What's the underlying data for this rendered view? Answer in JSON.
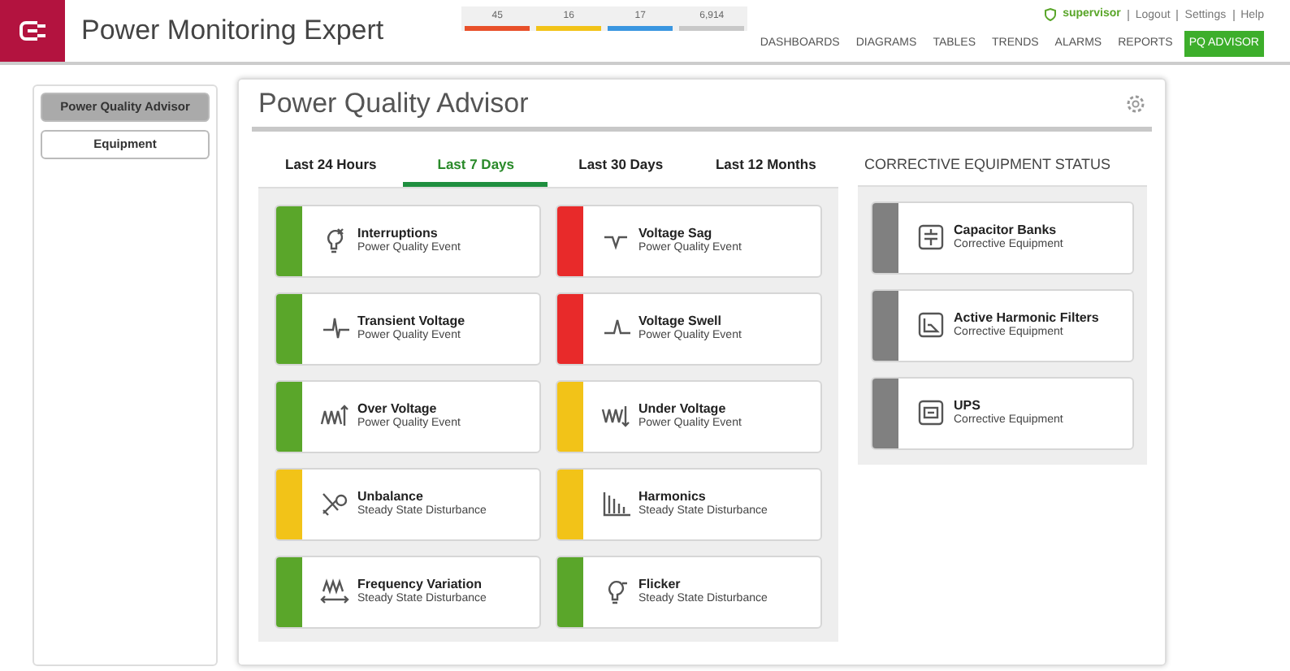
{
  "app": {
    "title": "Power Monitoring Expert"
  },
  "alarm_counts": [
    {
      "count": "45",
      "color": "#e8502a"
    },
    {
      "count": "16",
      "color": "#f2c318"
    },
    {
      "count": "17",
      "color": "#3a96e0"
    },
    {
      "count": "6,914",
      "color": "#c8c8c8"
    }
  ],
  "user_links": {
    "user": "supervisor",
    "links": [
      "Logout",
      "Settings",
      "Help"
    ]
  },
  "nav": [
    {
      "label": "DASHBOARDS",
      "selected": false
    },
    {
      "label": "DIAGRAMS",
      "selected": false
    },
    {
      "label": "TABLES",
      "selected": false
    },
    {
      "label": "TRENDS",
      "selected": false
    },
    {
      "label": "ALARMS",
      "selected": false
    },
    {
      "label": "REPORTS",
      "selected": false
    },
    {
      "label": "PQ ADVISOR",
      "selected": true
    }
  ],
  "sidebar": {
    "items": [
      {
        "label": "Power Quality Advisor",
        "selected": true
      },
      {
        "label": "Equipment",
        "selected": false
      }
    ]
  },
  "panel": {
    "title": "Power Quality Advisor"
  },
  "period_tabs": [
    {
      "label": "Last 24 Hours",
      "selected": false
    },
    {
      "label": "Last 7 Days",
      "selected": true
    },
    {
      "label": "Last 30 Days",
      "selected": false
    },
    {
      "label": "Last 12 Months",
      "selected": false
    }
  ],
  "events": [
    {
      "name": "Interruptions",
      "category": "Power Quality Event",
      "color": "#5aa62a"
    },
    {
      "name": "Voltage Sag",
      "category": "Power Quality Event",
      "color": "#e82a2a"
    },
    {
      "name": "Transient Voltage",
      "category": "Power Quality Event",
      "color": "#5aa62a"
    },
    {
      "name": "Voltage Swell",
      "category": "Power Quality Event",
      "color": "#e82a2a"
    },
    {
      "name": "Over Voltage",
      "category": "Power Quality Event",
      "color": "#5aa62a"
    },
    {
      "name": "Under Voltage",
      "category": "Power Quality Event",
      "color": "#f2c318"
    },
    {
      "name": "Unbalance",
      "category": "Steady State Disturbance",
      "color": "#f2c318"
    },
    {
      "name": "Harmonics",
      "category": "Steady State Disturbance",
      "color": "#f2c318"
    },
    {
      "name": "Frequency Variation",
      "category": "Steady State Disturbance",
      "color": "#5aa62a"
    },
    {
      "name": "Flicker",
      "category": "Steady State Disturbance",
      "color": "#5aa62a"
    }
  ],
  "corrective": {
    "title": "CORRECTIVE EQUIPMENT STATUS",
    "items": [
      {
        "name": "Capacitor Banks",
        "category": "Corrective Equipment",
        "color": "#808080"
      },
      {
        "name": "Active Harmonic Filters",
        "category": "Corrective Equipment",
        "color": "#808080"
      },
      {
        "name": "UPS",
        "category": "Corrective Equipment",
        "color": "#808080"
      }
    ]
  }
}
